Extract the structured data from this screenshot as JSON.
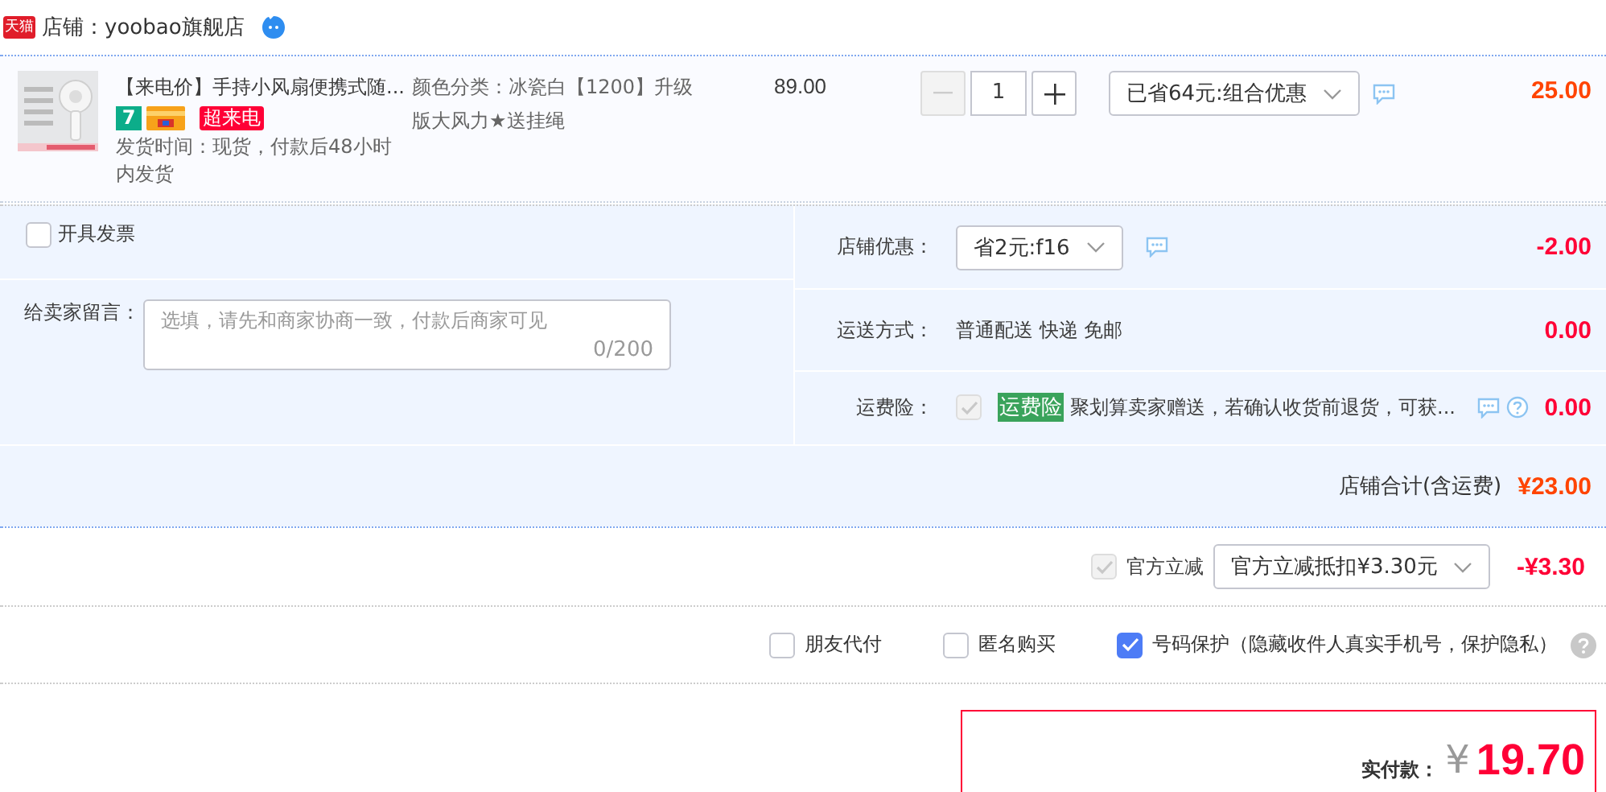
{
  "shop": {
    "logo": "天猫",
    "name": "店铺：yoobao旗舰店"
  },
  "item": {
    "title": "【来电价】手持小风扇便携式随...",
    "badges": [
      {
        "kind": "number",
        "text": "7"
      },
      {
        "kind": "card"
      },
      {
        "kind": "label",
        "text": "超来电"
      }
    ],
    "shipping_time": "发货时间：现货，付款后48小时内发货",
    "spec": "颜色分类：冰瓷白【1200】升级版大风力★送挂绳",
    "unit_price": "89.00",
    "quantity": "1",
    "decrease_disabled": true,
    "promo": "已省64元:组合优惠",
    "subtotal": "25.00"
  },
  "invoice": {
    "label": "开具发票",
    "checked": false
  },
  "message": {
    "label": "给卖家留言：",
    "placeholder": "选填，请先和商家协商一致，付款后商家可见",
    "counter": "0/200"
  },
  "store_discount": {
    "label": "店铺优惠：",
    "option": "省2元:f16",
    "amount": "-2.00"
  },
  "delivery": {
    "label": "运送方式：",
    "method": "普通配送 快递 免邮",
    "amount": "0.00"
  },
  "insurance": {
    "label": "运费险：",
    "checked": true,
    "disabled": true,
    "tag": "运费险",
    "text": "聚划算卖家赠送，若确认收货前退货，可获...",
    "amount": "0.00"
  },
  "store_total": {
    "label": "店铺合计(含运费)",
    "amount": "¥23.00"
  },
  "official_discount": {
    "label": "官方立减",
    "checked": true,
    "disabled": true,
    "option": "官方立减抵扣¥3.30元",
    "amount": "-¥3.30"
  },
  "options": [
    {
      "label": "朋友代付",
      "checked": false
    },
    {
      "label": "匿名购买",
      "checked": false
    },
    {
      "label": "号码保护（隐藏收件人真实手机号，保护隐私）",
      "checked": true
    }
  ],
  "payment": {
    "label": "实付款：",
    "currency": "¥",
    "amount": "19.70"
  }
}
